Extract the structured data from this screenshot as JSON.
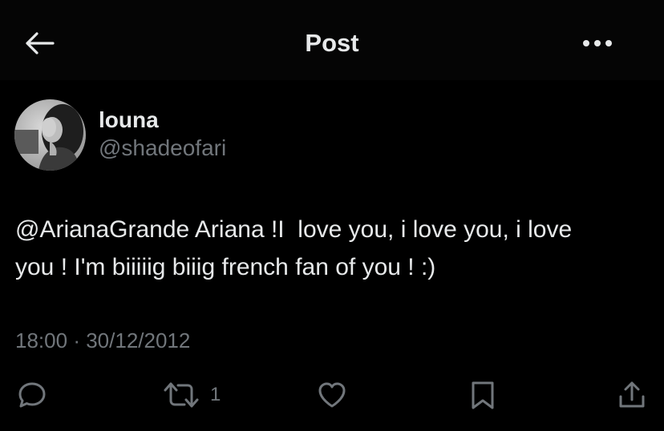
{
  "header": {
    "title": "Post",
    "back_icon": "arrow-left-icon",
    "more_icon": "more-horizontal-icon"
  },
  "post": {
    "author": {
      "display_name": "louna",
      "handle": "@shadeofari"
    },
    "text": "@ArianaGrande Ariana !I  love you, i love you, i love\nyou ! I'm biiiiig biiig french fan of you ! :)",
    "time": "18:00",
    "separator": "·",
    "date": "30/12/2012",
    "actions": {
      "reply_icon": "reply-icon",
      "retweet_icon": "retweet-icon",
      "retweet_count": "1",
      "like_icon": "heart-icon",
      "bookmark_icon": "bookmark-icon",
      "share_icon": "share-icon"
    }
  },
  "colors": {
    "background": "#000000",
    "header_background": "#050505",
    "primary_text": "#e7e9ea",
    "secondary_text": "#71767b"
  }
}
